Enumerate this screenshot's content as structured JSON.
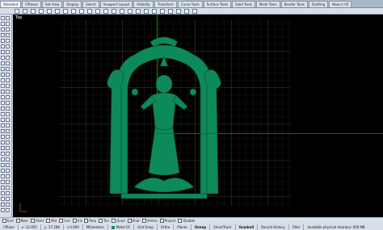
{
  "tabs": [
    "Standard",
    "CPlanes",
    "Set View",
    "Display",
    "Select",
    "Viewport Layout",
    "Visibility",
    "Transform",
    "Curve Tools",
    "Surface Tools",
    "Solid Tools",
    "Mesh Tools",
    "Render Tools",
    "Drafting",
    "New in V5"
  ],
  "active_tab_index": 0,
  "viewport": {
    "label": "Top"
  },
  "osnaps": [
    "End",
    "Near",
    "Point",
    "Mid",
    "Cen",
    "Int",
    "Perp",
    "Tan",
    "Quad",
    "Knot",
    "Vertex",
    "Project",
    "Disable"
  ],
  "status": {
    "cplane": "CPlane",
    "x": "x -12.955",
    "y": "y -17.288",
    "z": "z 0.000",
    "units": "Millimeters",
    "layer": "Metal 01",
    "grid_snap": "Grid Snap",
    "ortho": "Ortho",
    "planar": "Planar",
    "osnap": "Osnap",
    "smarttrack": "SmartTrack",
    "gumball": "Gumball",
    "record_history": "Record History",
    "filter": "Filter",
    "memory": "Available physical memory: 658 MB"
  },
  "colors": {
    "model": "#0d8a5a",
    "axis_x": "#c21515",
    "axis_y": "#148a14",
    "grid": "#3a3a3a"
  }
}
